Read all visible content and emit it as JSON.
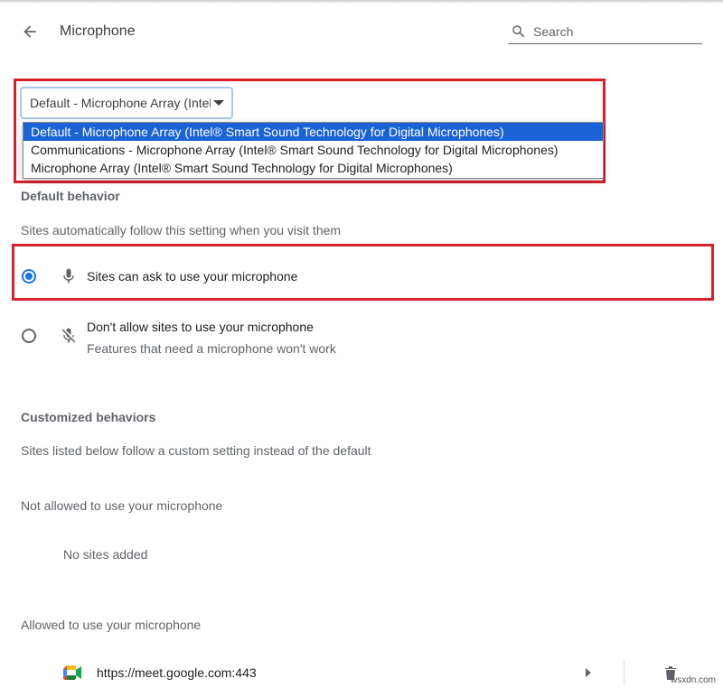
{
  "header": {
    "title": "Microphone",
    "search_placeholder": "Search"
  },
  "device_select": {
    "selected_display": "Default - Microphone Array (Intel® Smart Sound Technology for Digital Microphones)",
    "options": [
      "Default - Microphone Array (Intel® Smart Sound Technology for Digital Microphones)",
      "Communications - Microphone Array (Intel® Smart Sound Technology for Digital Microphones)",
      "Microphone Array (Intel® Smart Sound Technology for Digital Microphones)"
    ],
    "selected_index": 0
  },
  "default_behavior": {
    "heading": "Default behavior",
    "description": "Sites automatically follow this setting when you visit them",
    "options": [
      {
        "label": "Sites can ask to use your microphone",
        "sublabel": "",
        "icon": "microphone-icon",
        "checked": true
      },
      {
        "label": "Don't allow sites to use your microphone",
        "sublabel": "Features that need a microphone won't work",
        "icon": "microphone-off-icon",
        "checked": false
      }
    ]
  },
  "customized": {
    "heading": "Customized behaviors",
    "description": "Sites listed below follow a custom setting instead of the default",
    "not_allowed": {
      "label": "Not allowed to use your microphone",
      "empty_text": "No sites added"
    },
    "allowed": {
      "label": "Allowed to use your microphone",
      "sites": [
        {
          "url": "https://meet.google.com:443",
          "icon": "google-meet-icon"
        }
      ]
    }
  },
  "watermark": "wsxdn.com",
  "colors": {
    "accent": "#1a73e8",
    "highlight_box": "#d9202b",
    "dropdown_selected": "#1a62d6"
  }
}
